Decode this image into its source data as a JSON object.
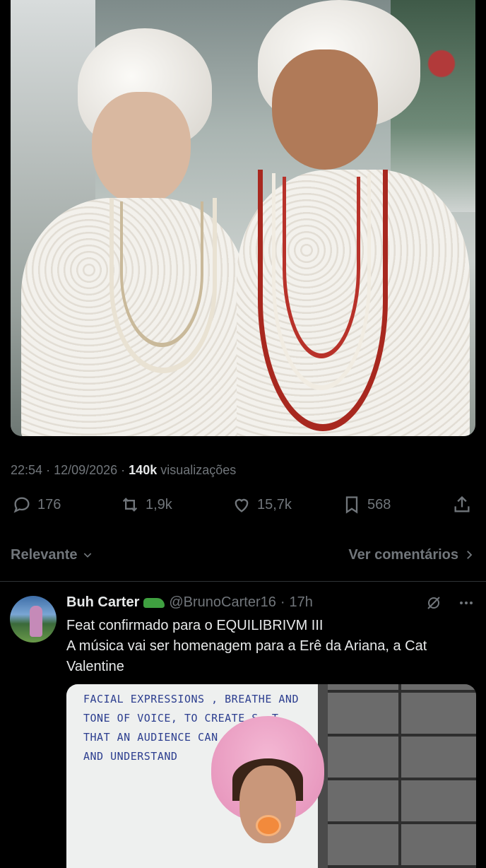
{
  "post": {
    "time": "22:54",
    "date": "12/09/2026",
    "views_count": "140k",
    "views_label": "visualizações",
    "stats": {
      "replies": "176",
      "reposts": "1,9k",
      "likes": "15,7k",
      "bookmarks": "568"
    }
  },
  "sort": {
    "relevance_label": "Relevante",
    "view_comments_label": "Ver comentários"
  },
  "reply": {
    "name": "Buh Carter",
    "handle": "@BrunoCarter16",
    "time": "17h",
    "text_line1": "Feat confirmado para o EQUILIBRIVM III",
    "text_line2": "A música vai ser homenagem para a Erê da Ariana, a Cat Valentine",
    "whiteboard_text": "FACIAL EXPRESSIONS , BREATHE AND\nTONE OF VOICE, TO CREATE S  T\nTHAT AN AUDIENCE CAN  \nAND UNDERSTAND"
  },
  "icons": {
    "reply": "speech-bubble-icon",
    "repost": "repost-arrows-icon",
    "like": "heart-icon",
    "bookmark": "bookmark-icon",
    "share": "share-icon",
    "grok": "grok-icon",
    "more": "more-dots-icon",
    "verified_emoji": "crocodile-emoji"
  }
}
